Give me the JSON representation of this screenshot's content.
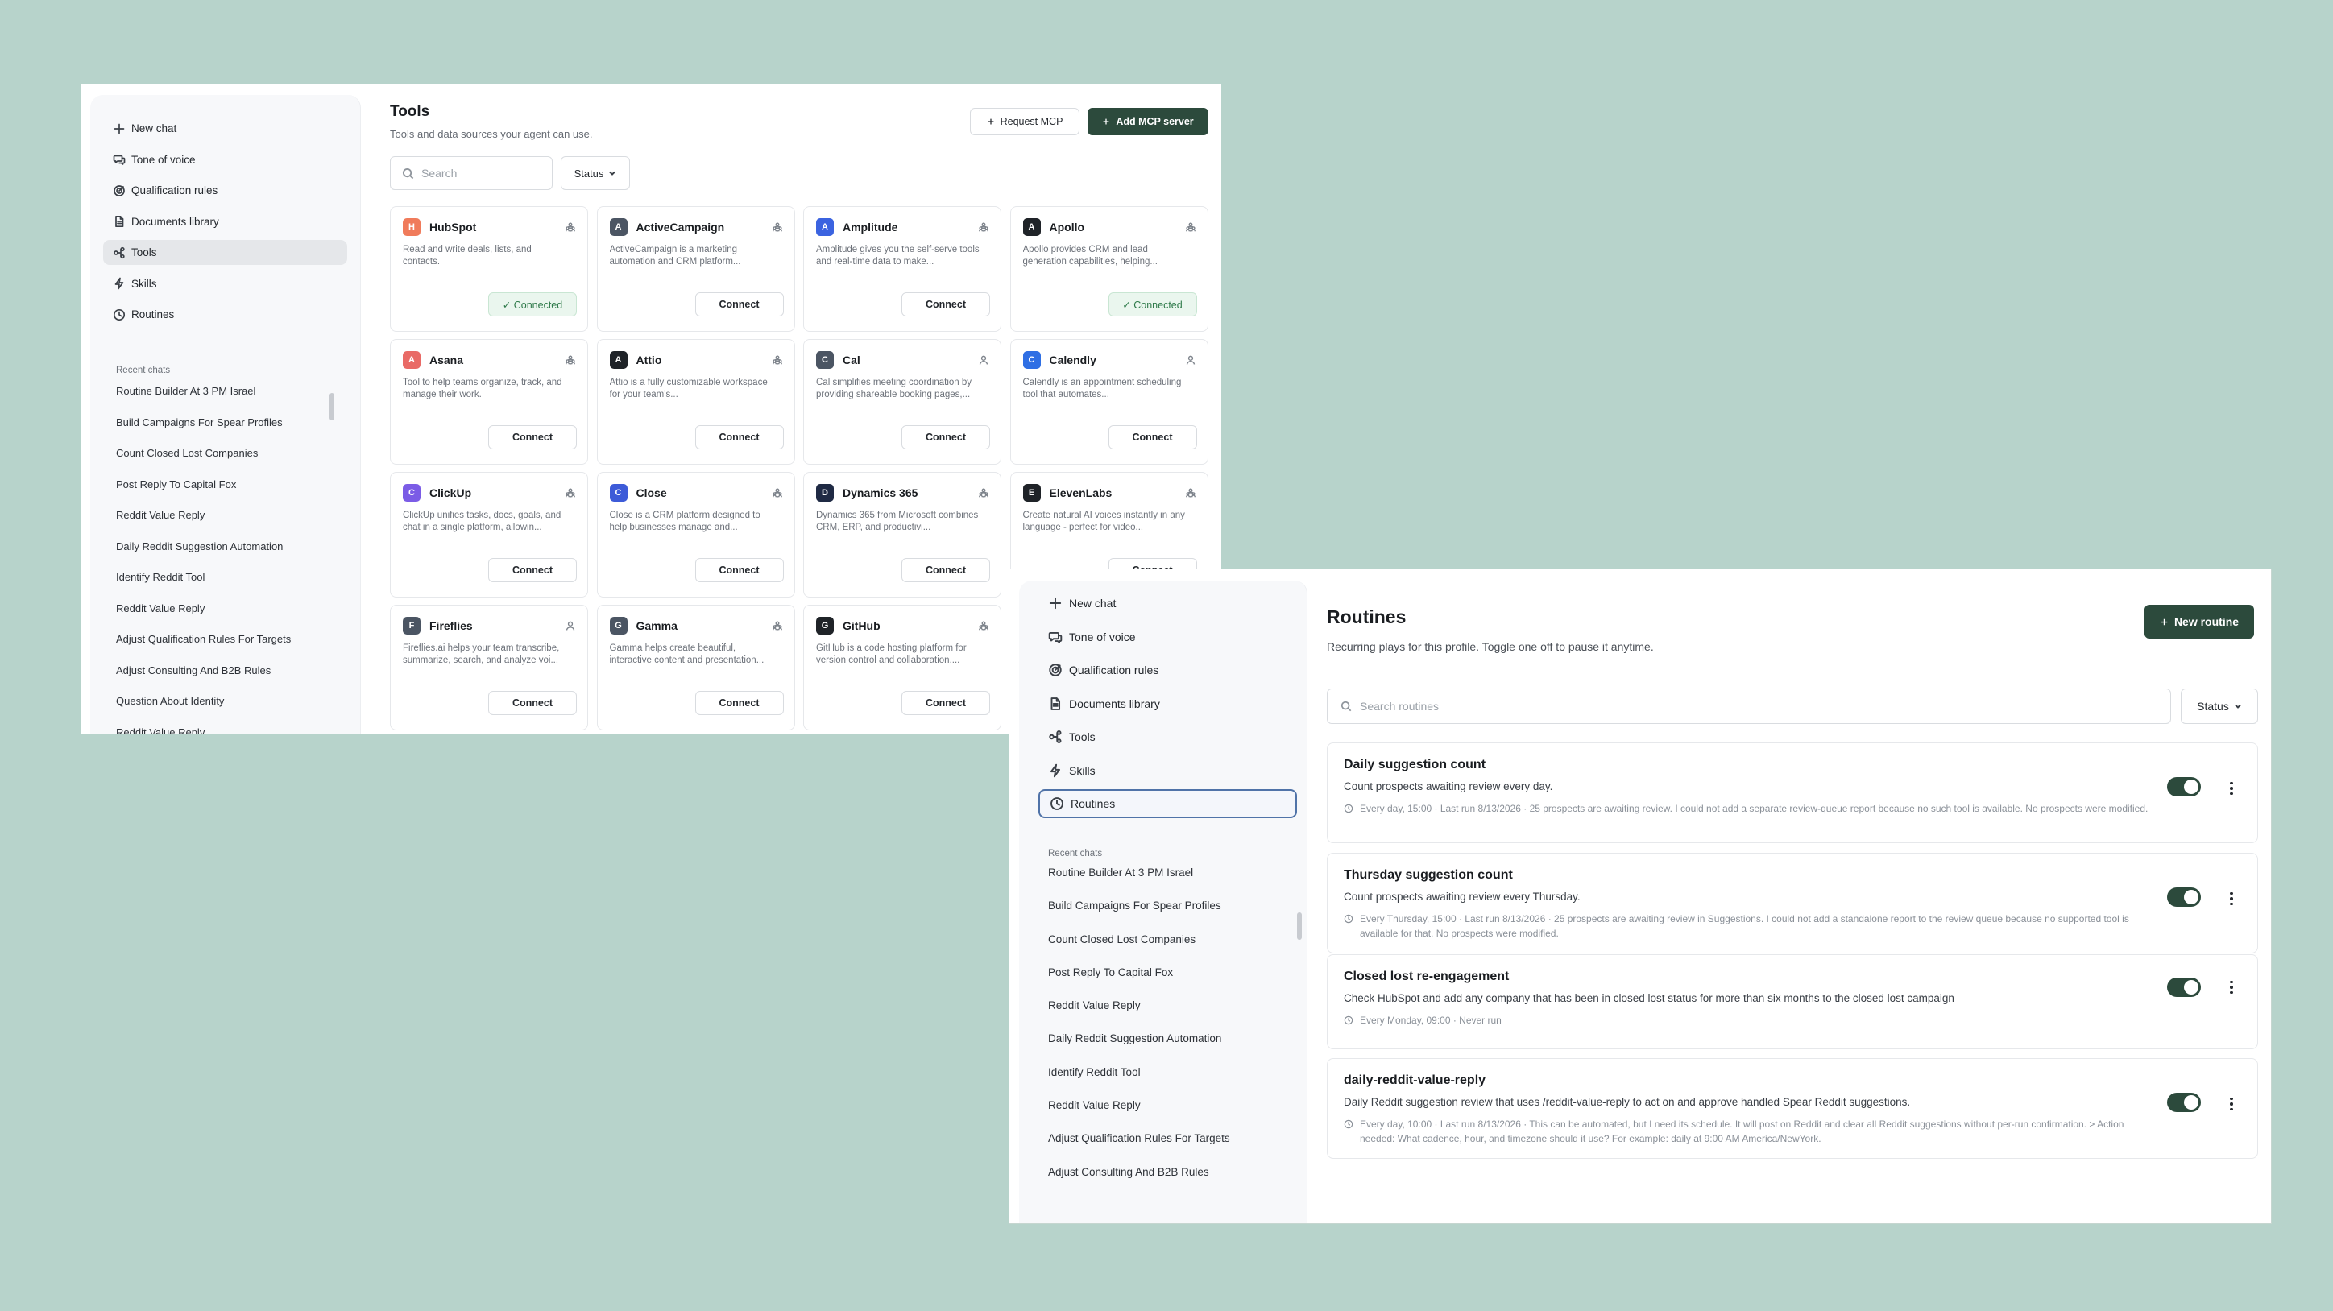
{
  "nav": {
    "new_chat": "New chat",
    "tone_of_voice": "Tone of voice",
    "qualification_rules": "Qualification rules",
    "documents_library": "Documents library",
    "tools": "Tools",
    "skills": "Skills",
    "routines": "Routines"
  },
  "recent_chats": {
    "heading": "Recent chats",
    "items": [
      "Routine Builder At 3 PM Israel",
      "Build Campaigns For Spear Profiles",
      "Count Closed Lost Companies",
      "Post Reply To Capital Fox",
      "Reddit Value Reply",
      "Daily Reddit Suggestion Automation",
      "Identify Reddit Tool",
      "Reddit Value Reply",
      "Adjust Qualification Rules For Targets",
      "Adjust Consulting And B2B Rules",
      "Question About Identity",
      "Reddit Value Reply"
    ]
  },
  "tools_page": {
    "title": "Tools",
    "subtitle": "Tools and data sources your agent can use.",
    "request_mcp": "Request MCP",
    "add_mcp_server": "Add MCP server",
    "search_placeholder": "Search",
    "status_filter": "Status",
    "connect_label": "Connect",
    "connected_label": "✓ Connected",
    "cards": [
      {
        "initial": "H",
        "name": "HubSpot",
        "desc": "Read and write deals, lists, and contacts.",
        "color": "#f07b5b",
        "icon": "team-icon",
        "connected": true
      },
      {
        "initial": "A",
        "name": "ActiveCampaign",
        "desc": "ActiveCampaign is a marketing automation and CRM platform...",
        "color": "#4b5563",
        "icon": "team-icon",
        "connected": false
      },
      {
        "initial": "A",
        "name": "Amplitude",
        "desc": "Amplitude gives you the self-serve tools and real-time data to make...",
        "color": "#3b63e0",
        "icon": "team-icon",
        "connected": false
      },
      {
        "initial": "A",
        "name": "Apollo",
        "desc": "Apollo provides CRM and lead generation capabilities, helping...",
        "color": "#1f2328",
        "icon": "team-icon",
        "connected": true
      },
      {
        "initial": "A",
        "name": "Asana",
        "desc": "Tool to help teams organize, track, and manage their work.",
        "color": "#e96a66",
        "icon": "team-icon",
        "connected": false
      },
      {
        "initial": "A",
        "name": "Attio",
        "desc": "Attio is a fully customizable workspace for your team's...",
        "color": "#1f2328",
        "icon": "team-icon",
        "connected": false
      },
      {
        "initial": "C",
        "name": "Cal",
        "desc": "Cal simplifies meeting coordination by providing shareable booking pages,...",
        "color": "#4b5563",
        "icon": "user-icon",
        "connected": false
      },
      {
        "initial": "C",
        "name": "Calendly",
        "desc": "Calendly is an appointment scheduling tool that automates...",
        "color": "#2f6fe4",
        "icon": "user-icon",
        "connected": false
      },
      {
        "initial": "C",
        "name": "ClickUp",
        "desc": "ClickUp unifies tasks, docs, goals, and chat in a single platform, allowin...",
        "color": "#7b5ce6",
        "icon": "team-icon",
        "connected": false
      },
      {
        "initial": "C",
        "name": "Close",
        "desc": "Close is a CRM platform designed to help businesses manage and...",
        "color": "#3d5bd8",
        "icon": "team-icon",
        "connected": false
      },
      {
        "initial": "D",
        "name": "Dynamics 365",
        "desc": "Dynamics 365 from Microsoft combines CRM, ERP, and productivi...",
        "color": "#1f2a44",
        "icon": "team-icon",
        "connected": false
      },
      {
        "initial": "E",
        "name": "ElevenLabs",
        "desc": "Create natural AI voices instantly in any language - perfect for video...",
        "color": "#1f2328",
        "icon": "team-icon",
        "connected": false
      },
      {
        "initial": "F",
        "name": "Fireflies",
        "desc": "Fireflies.ai helps your team transcribe, summarize, search, and analyze voi...",
        "color": "#4b5563",
        "icon": "user-icon",
        "connected": false
      },
      {
        "initial": "G",
        "name": "Gamma",
        "desc": "Gamma helps create beautiful, interactive content and presentation...",
        "color": "#4b5563",
        "icon": "team-icon",
        "connected": false
      },
      {
        "initial": "G",
        "name": "GitHub",
        "desc": "GitHub is a code hosting platform for version control and collaboration,...",
        "color": "#1f2328",
        "icon": "team-icon",
        "connected": false
      }
    ]
  },
  "routines_page": {
    "title": "Routines",
    "subtitle": "Recurring plays for this profile. Toggle one off to pause it anytime.",
    "new_routine": "New routine",
    "search_placeholder": "Search routines",
    "status_filter": "Status",
    "items": [
      {
        "title": "Daily suggestion count",
        "desc": "Count prospects awaiting review every day.",
        "meta": "Every day, 15:00 · Last run 8/13/2026 · 25 prospects are awaiting review. I could not add a separate review-queue report because no such tool is available. No prospects were modified.",
        "enabled": true
      },
      {
        "title": "Thursday suggestion count",
        "desc": "Count prospects awaiting review every Thursday.",
        "meta": "Every Thursday, 15:00 · Last run 8/13/2026 · 25 prospects are awaiting review in Suggestions. I could not add a standalone report to the review queue because no supported tool is available for that. No prospects were modified.",
        "enabled": true
      },
      {
        "title": "Closed lost re-engagement",
        "desc": "Check HubSpot and add any company that has been in closed lost status for more than six months to the closed lost campaign",
        "meta": "Every Monday, 09:00 · Never run",
        "enabled": true
      },
      {
        "title": "daily-reddit-value-reply",
        "desc": "Daily Reddit suggestion review that uses /reddit-value-reply to act on and approve handled Spear Reddit suggestions.",
        "meta": "Every day, 10:00 · Last run 8/13/2026 · This can be automated, but I need its schedule. It will post on Reddit and clear all Reddit suggestions without per-run confirmation. > Action needed: What cadence, hour, and timezone should it use? For example: daily at 9:00 AM America/NewYork.",
        "enabled": true
      }
    ]
  }
}
